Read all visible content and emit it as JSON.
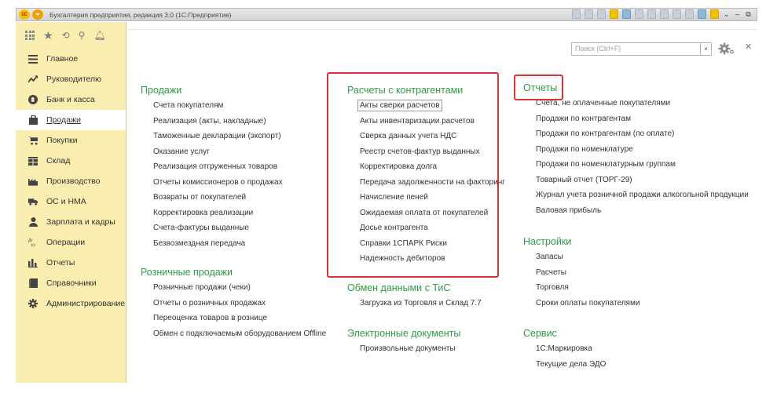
{
  "window": {
    "title": "Бухгалтерия предприятия, редакция 3.0  (1С:Предприятие)",
    "logo": "1С"
  },
  "search": {
    "placeholder": "Поиск (Ctrl+F)",
    "clear_label": "×"
  },
  "sidebar": {
    "items": [
      {
        "label": "Главное",
        "icon": "menu-lines-icon"
      },
      {
        "label": "Руководителю",
        "icon": "trend-icon"
      },
      {
        "label": "Банк и касса",
        "icon": "coin-icon"
      },
      {
        "label": "Продажи",
        "icon": "bag-icon",
        "active": true
      },
      {
        "label": "Покупки",
        "icon": "cart-icon"
      },
      {
        "label": "Склад",
        "icon": "warehouse-icon"
      },
      {
        "label": "Производство",
        "icon": "factory-icon"
      },
      {
        "label": "ОС и НМА",
        "icon": "truck-icon"
      },
      {
        "label": "Зарплата и кадры",
        "icon": "person-icon"
      },
      {
        "label": "Операции",
        "icon": "dt-kt-icon"
      },
      {
        "label": "Отчеты",
        "icon": "bar-chart-icon"
      },
      {
        "label": "Справочники",
        "icon": "book-icon"
      },
      {
        "label": "Администрирование",
        "icon": "gear-icon"
      }
    ]
  },
  "columns": {
    "sales": {
      "title": "Продажи",
      "links": [
        "Счета покупателям",
        "Реализация (акты, накладные)",
        "Таможенные декларации (экспорт)",
        "Оказание услуг",
        "Реализация отгруженных товаров",
        "Отчеты комиссионеров о продажах",
        "Возвраты от покупателей",
        "Корректировка реализации",
        "Счета-фактуры выданные",
        "Безвозмездная передача"
      ]
    },
    "retail": {
      "title": "Розничные продажи",
      "links": [
        "Розничные продажи (чеки)",
        "Отчеты о розничных продажах",
        "Переоценка товаров в рознице",
        "Обмен с подключаемым оборудованием Offline"
      ]
    },
    "contractors": {
      "title": "Расчеты с контрагентами",
      "links": [
        "Акты сверки расчетов",
        "Акты инвентаризации расчетов",
        "Сверка данных учета НДС",
        "Реестр счетов-фактур выданных",
        "Корректировка долга",
        "Передача задолженности на факторинг",
        "Начисление пеней",
        "Ожидаемая оплата от покупателей",
        "Досье контрагента",
        "Справки 1СПАРК Риски",
        "Надежность дебиторов"
      ]
    },
    "exchange": {
      "title": "Обмен данными с ТиС",
      "links": [
        "Загрузка из Торговля и Склад 7.7"
      ]
    },
    "edocs": {
      "title": "Электронные документы",
      "links": [
        "Произвольные документы"
      ]
    },
    "reports": {
      "title": "Отчеты",
      "links": [
        "Счета, не оплаченные покупателями",
        "Продажи по контрагентам",
        "Продажи по контрагентам (по оплате)",
        "Продажи по номенклатуре",
        "Продажи по номенклатурным группам",
        "Товарный отчет (ТОРГ-29)",
        "Журнал учета розничной продажи алкогольной продукции",
        "Валовая прибыль"
      ]
    },
    "settings": {
      "title": "Настройки",
      "links": [
        "Запасы",
        "Расчеты",
        "Торговля",
        "Сроки оплаты покупателями"
      ]
    },
    "service": {
      "title": "Сервис",
      "links": [
        "1С:Маркировка",
        "Текущие дела ЭДО"
      ]
    }
  },
  "colors": {
    "accent_green": "#2e9b46",
    "sidebar_bg": "#faedb0",
    "highlight_red": "#d9333a"
  }
}
